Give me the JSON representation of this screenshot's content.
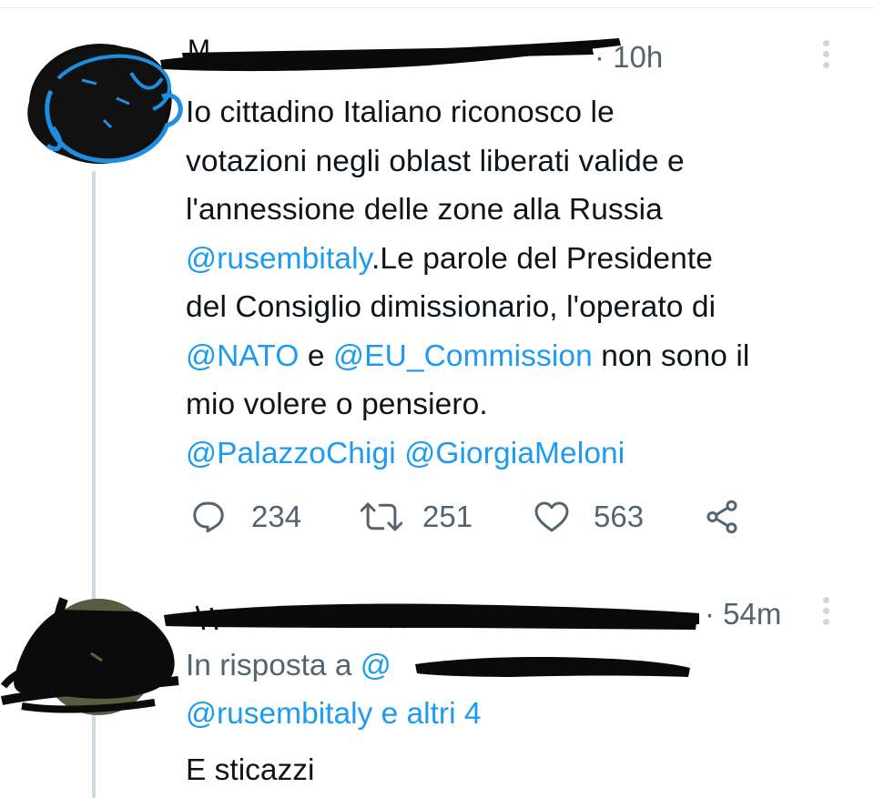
{
  "tweet1": {
    "time": "· 10h",
    "text_lines": [
      [
        {
          "t": "Io cittadino Italiano riconosco le"
        }
      ],
      [
        {
          "t": "votazioni negli oblast liberati valide e"
        }
      ],
      [
        {
          "t": "l'annessione delle zone alla Russia"
        }
      ],
      [
        {
          "t": "@rusembitaly",
          "m": true
        },
        {
          "t": ".Le parole del Presidente"
        }
      ],
      [
        {
          "t": "del Consiglio dimissionario, l'operato di"
        }
      ],
      [
        {
          "t": "@NATO",
          "m": true
        },
        {
          "t": " e "
        },
        {
          "t": "@EU_Commission",
          "m": true
        },
        {
          "t": " non sono il"
        }
      ],
      [
        {
          "t": "mio volere o pensiero."
        }
      ],
      [
        {
          "t": " "
        },
        {
          "t": "@PalazzoChigi",
          "m": true
        },
        {
          "t": " "
        },
        {
          "t": "@GiorgiaMeloni",
          "m": true
        }
      ]
    ],
    "actions": {
      "reply_count": "234",
      "retweet_count": "251",
      "like_count": "563"
    },
    "icons": [
      "reply-icon",
      "retweet-icon",
      "like-icon",
      "share-icon",
      "more-icon"
    ]
  },
  "tweet2": {
    "time": "· 54m",
    "reply_prefix": "In risposta a",
    "reply_mention_partial": "@",
    "reply_mention_visible": "@rusembitaly",
    "reply_others": " e altri 4",
    "text": "E sticazzi"
  },
  "colors": {
    "text": "#0f1419",
    "muted": "#536471",
    "mention": "#1d9bf0",
    "thread_line": "#cfd9de",
    "scribble_blue": "#1d8fe0",
    "redaction": "#0a0a0a"
  }
}
